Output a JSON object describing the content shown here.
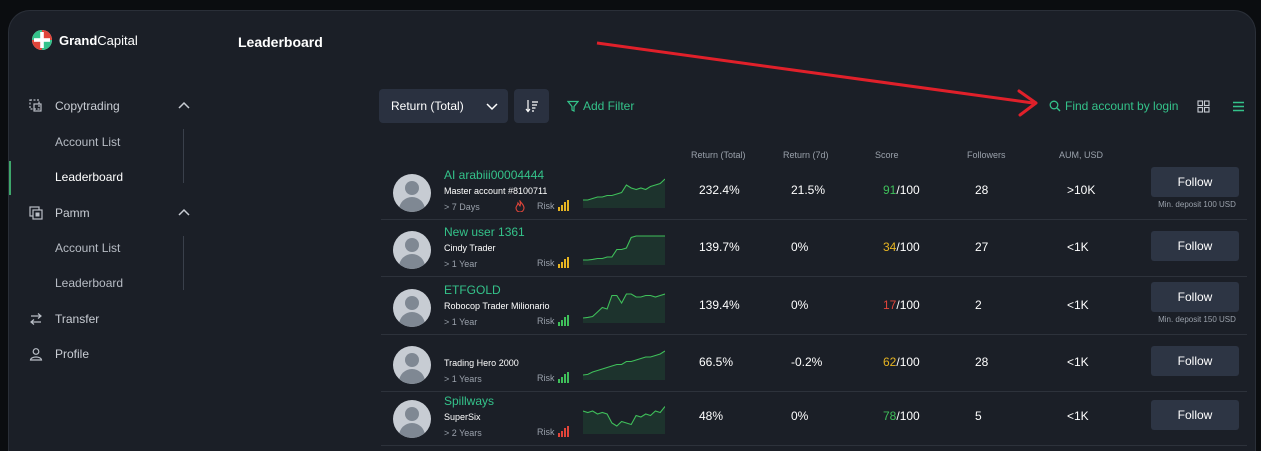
{
  "brand": {
    "name_bold": "Grand",
    "name_light": "Capital"
  },
  "header": {
    "title": "Leaderboard"
  },
  "sidebar": {
    "sections": [
      {
        "label": "Copytrading",
        "icon": "copytrading-icon",
        "items": [
          {
            "label": "Account List"
          },
          {
            "label": "Leaderboard",
            "active": true
          }
        ]
      },
      {
        "label": "Pamm",
        "icon": "pamm-icon",
        "items": [
          {
            "label": "Account List"
          },
          {
            "label": "Leaderboard"
          }
        ]
      }
    ],
    "transfer": "Transfer",
    "profile": "Profile"
  },
  "toolbar": {
    "sort_select": "Return (Total)",
    "add_filter": "Add Filter",
    "find_account": "Find account by login"
  },
  "columns": [
    "Return (Total)",
    "Return (7d)",
    "Score",
    "Followers",
    "AUM, USD"
  ],
  "rows": [
    {
      "nick": "AI arabiii00004444",
      "name": "Master account #8100711",
      "period": "> 7 Days",
      "risk_label": "Risk",
      "risk_level": 4,
      "risk_color": "#e6b422",
      "flame": true,
      "return_total": "232.4%",
      "return_7d": "21.5%",
      "score": "91",
      "score_max": "/100",
      "score_color": "#3fbf5a",
      "followers": "28",
      "aum": ">10K",
      "follow": "Follow",
      "min_deposit": "Min. deposit 100 USD",
      "spark": [
        0.2,
        0.2,
        0.25,
        0.3,
        0.3,
        0.35,
        0.35,
        0.4,
        0.45,
        0.7,
        0.6,
        0.55,
        0.6,
        0.55,
        0.65,
        0.7,
        0.75,
        0.9
      ]
    },
    {
      "nick": "New user 1361",
      "name": "Cindy Trader",
      "period": "> 1 Year",
      "risk_label": "Risk",
      "risk_level": 4,
      "risk_color": "#e6b422",
      "flame": false,
      "return_total": "139.7%",
      "return_7d": "0%",
      "score": "34",
      "score_max": "/100",
      "score_color": "#e6b422",
      "followers": "27",
      "aum": "<1K",
      "follow": "Follow",
      "min_deposit": "",
      "spark": [
        0.1,
        0.1,
        0.12,
        0.15,
        0.15,
        0.2,
        0.2,
        0.45,
        0.45,
        0.5,
        0.85,
        0.9,
        0.9,
        0.9,
        0.9,
        0.9,
        0.9,
        0.9
      ]
    },
    {
      "nick": "ETFGOLD",
      "name": "Robocop Trader Milionario",
      "period": "> 1 Year",
      "risk_label": "Risk",
      "risk_level": 4,
      "risk_color": "#3fbf5a",
      "flame": false,
      "return_total": "139.4%",
      "return_7d": "0%",
      "score": "17",
      "score_max": "/100",
      "score_color": "#e0453a",
      "followers": "2",
      "aum": "<1K",
      "follow": "Follow",
      "min_deposit": "Min. deposit 150 USD",
      "spark": [
        0.1,
        0.12,
        0.15,
        0.3,
        0.45,
        0.4,
        0.85,
        0.85,
        0.6,
        0.9,
        0.9,
        0.8,
        0.8,
        0.85,
        0.85,
        0.8,
        0.85,
        0.9
      ]
    },
    {
      "nick": "",
      "name": "Trading Hero 2000",
      "period": "> 1 Years",
      "risk_label": "Risk",
      "risk_level": 4,
      "risk_color": "#3fbf5a",
      "flame": false,
      "return_total": "66.5%",
      "return_7d": "-0.2%",
      "score": "62",
      "score_max": "/100",
      "score_color": "#e6b422",
      "followers": "28",
      "aum": "<1K",
      "follow": "Follow",
      "min_deposit": "",
      "spark": [
        0.1,
        0.12,
        0.2,
        0.25,
        0.3,
        0.35,
        0.4,
        0.45,
        0.45,
        0.55,
        0.55,
        0.6,
        0.65,
        0.7,
        0.7,
        0.75,
        0.8,
        0.9
      ]
    },
    {
      "nick": "Spillways",
      "name": "SuperSix",
      "period": "> 2 Years",
      "risk_label": "Risk",
      "risk_level": 4,
      "risk_color": "#e0453a",
      "flame": false,
      "return_total": "48%",
      "return_7d": "0%",
      "score": "78",
      "score_max": "/100",
      "score_color": "#3fbf5a",
      "followers": "5",
      "aum": "<1K",
      "follow": "Follow",
      "min_deposit": "",
      "spark": [
        0.7,
        0.65,
        0.7,
        0.6,
        0.65,
        0.6,
        0.3,
        0.2,
        0.35,
        0.3,
        0.25,
        0.55,
        0.5,
        0.6,
        0.55,
        0.7,
        0.65,
        0.85
      ]
    }
  ],
  "colors": {
    "accent": "#34c28a",
    "panel": "#1b1f27",
    "arrow": "#e0202a"
  }
}
